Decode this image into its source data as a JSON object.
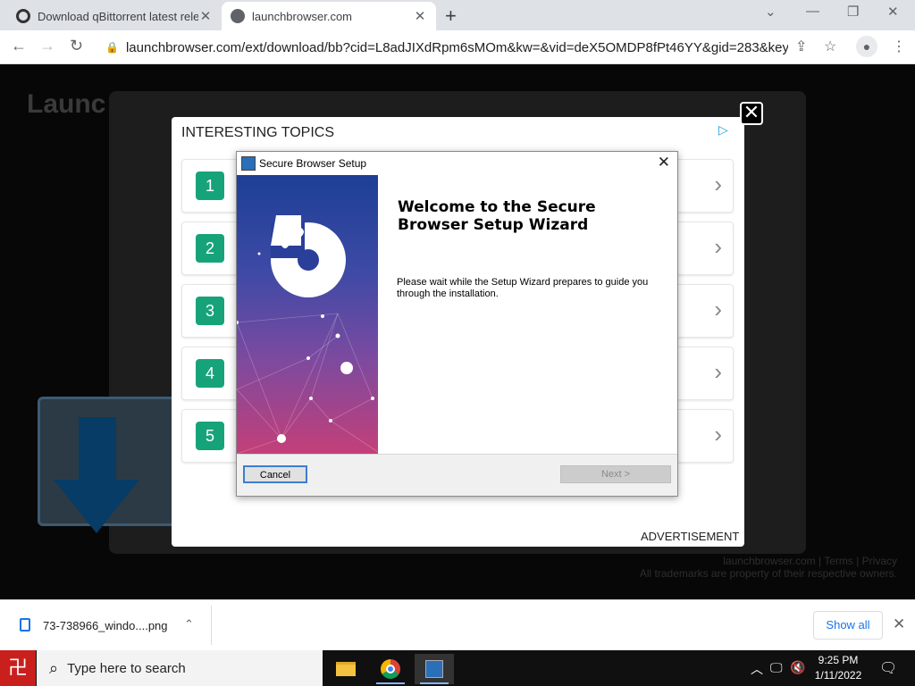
{
  "browser": {
    "tabs": [
      {
        "label": "Download qBittorrent latest relea",
        "icon": "qbittorrent-icon"
      },
      {
        "label": "launchbrowser.com",
        "icon": "globe-icon"
      }
    ],
    "url": "launchbrowser.com/ext/download/bb?cid=L8adJIXdRpm6sMOm&kw=&vid=deX5OMDP8fPt46YY&gid=283&keywor..."
  },
  "page": {
    "bg_logo": "Launc",
    "footer_links": "launchbrowser.com | Terms | Privacy",
    "footer_note": "All trademarks are property of their respective owners."
  },
  "ad": {
    "title": "INTERESTING TOPICS",
    "topics": [
      "1",
      "2",
      "3",
      "4",
      "5"
    ],
    "label": "ADVERTISEMENT",
    "close_glyph": "✕"
  },
  "dialog": {
    "title": "Secure Browser Setup",
    "heading": "Welcome to the Secure Browser Setup Wizard",
    "description": "Please wait while the Setup Wizard prepares to guide you through the installation.",
    "cancel_label": "Cancel",
    "next_label": "Next >"
  },
  "downloads": {
    "filename": "73-738966_windo....png",
    "show_all": "Show all"
  },
  "taskbar": {
    "search_placeholder": "Type here to search",
    "time": "9:25 PM",
    "date": "1/11/2022"
  },
  "colors": {
    "accent_green": "#17a37a",
    "chrome_blue": "#1a73e8",
    "start_red": "#c9201e"
  }
}
